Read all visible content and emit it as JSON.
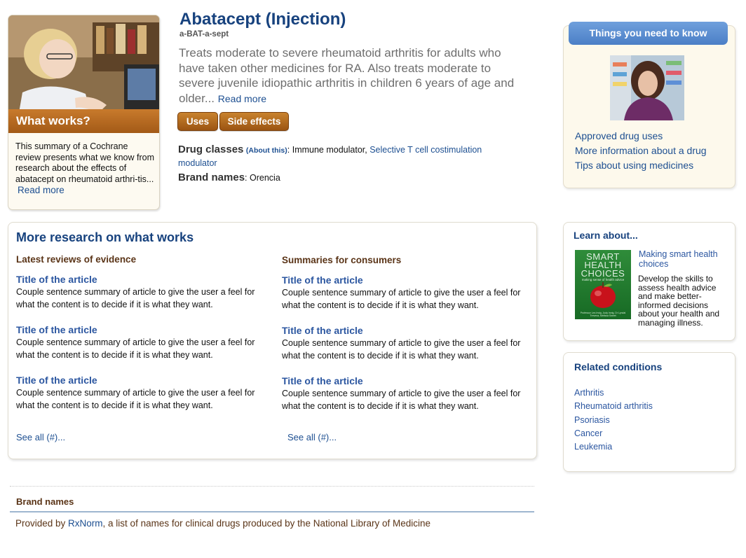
{
  "what_works": {
    "title": "What works?",
    "summary": "This summary of a Cochrane review presents what we know from research about the effects of abatacept on rheumatoid arthri-tis...",
    "read_more": "Read more"
  },
  "drug": {
    "name": "Abatacept (Injection)",
    "pronunciation": "a-BAT-a-sept",
    "description": "Treats moderate to severe rheumatoid arthritis for adults who have taken other medicines for RA. Also treats moderate to severe juvenile idiopathic arthritis in children 6 years of age and older...",
    "read_more": "Read more",
    "tabs": [
      "Uses",
      "Side effects"
    ],
    "drug_classes_label": "Drug classes",
    "about_this": "(About this)",
    "drug_classes": [
      "Immune modulator",
      "Selective T cell costimulation modulator"
    ],
    "brand_names_label": "Brand names",
    "brand_names": "Orencia"
  },
  "things": {
    "header": "Things you need to know",
    "links": [
      "Approved drug uses",
      "More information about a drug",
      "Tips about using medicines"
    ]
  },
  "research": {
    "title": "More research on what works",
    "columns": [
      {
        "heading": "Latest reviews of evidence",
        "articles": [
          {
            "title": "Title of the article",
            "summary": "Couple sentence summary of article to give the user a feel for what the content is to decide if it is what they want."
          },
          {
            "title": "Title of the article",
            "summary": "Couple sentence summary of article to give the user a feel for what the content is to decide if it is what they want."
          },
          {
            "title": "Title of the article",
            "summary": "Couple sentence summary of article to give the user a feel for what the content is to decide if it is what they want."
          }
        ],
        "see_all": "See all (#)..."
      },
      {
        "heading": "Summaries for consumers",
        "articles": [
          {
            "title": "Title of the article",
            "summary": "Couple sentence summary of article to give the user a feel for what the content is to decide if it is what they want."
          },
          {
            "title": "Title of the article",
            "summary": "Couple sentence summary of article to give the user a feel for what the content is to decide if it is what they want."
          },
          {
            "title": "Title of the article",
            "summary": "Couple sentence summary of article to give the user a feel for what the content is to decide if it is what they want."
          }
        ],
        "see_all": "See all (#)..."
      }
    ]
  },
  "learn": {
    "header": "Learn about...",
    "book_title_lines": [
      "SMART",
      "HEALTH",
      "CHOICES"
    ],
    "book_subtitle": "making sense of health advice",
    "book_authors": "Professor Les Irwig, Judy Irwig, Dr Lyndal Trevena, Melissa Sweet",
    "link": "Making smart health choices",
    "description": "Develop the skills to assess health advice and make better-informed decisions about your health and managing illness."
  },
  "related": {
    "header": "Related conditions",
    "items": [
      "Arthritis",
      "Rheumatoid arthritis",
      "Psoriasis",
      "Cancer",
      "Leukemia"
    ]
  },
  "footer": {
    "heading": "Brand names",
    "text_prefix": "Provided by ",
    "link": "RxNorm",
    "text_suffix": ", a list of names for clinical drugs produced by the National Library of Medicine"
  }
}
